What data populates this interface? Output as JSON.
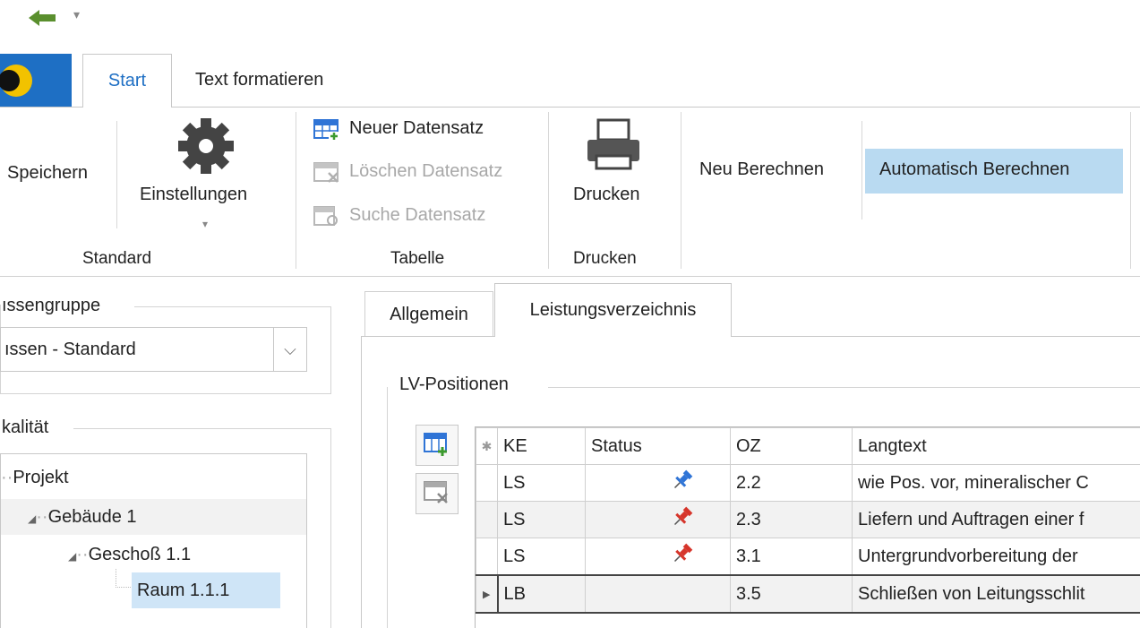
{
  "ribbon": {
    "tabs": [
      "Start",
      "Text formatieren"
    ],
    "buttons": {
      "speichern": "Speichern",
      "einstellungen": "Einstellungen",
      "neuer_datensatz": "Neuer Datensatz",
      "loeschen_datensatz": "Löschen Datensatz",
      "suche_datensatz": "Suche Datensatz",
      "drucken": "Drucken",
      "neu_berechnen": "Neu Berechnen",
      "automatisch_berechnen": "Automatisch Berechnen"
    },
    "groups": [
      "Standard",
      "Tabelle",
      "Drucken"
    ]
  },
  "left_panel": {
    "group1_title": "ıssengruppe",
    "combo_value": "ıssen - Standard",
    "group2_title": "kalität",
    "tree": [
      "Projekt",
      "Gebäude 1",
      "Geschoß 1.1",
      "Raum 1.1.1"
    ]
  },
  "detail_tabs": [
    "Allgemein",
    "Leistungsverzeichnis"
  ],
  "lv_group_title": "LV-Positionen",
  "grid": {
    "columns": [
      "KE",
      "Status",
      "OZ",
      "Langtext"
    ],
    "rows": [
      {
        "ke": "LS",
        "status": "pin-blue",
        "oz": "2.2",
        "langtext": "wie Pos. vor, mineralischer C"
      },
      {
        "ke": "LS",
        "status": "pin-red",
        "oz": "2.3",
        "langtext": "Liefern und Auftragen einer f"
      },
      {
        "ke": "LS",
        "status": "pin-red",
        "oz": "3.1",
        "langtext": "Untergrundvorbereitung der"
      },
      {
        "ke": "LB",
        "status": "",
        "oz": "3.5",
        "langtext": "Schließen von Leitungsschlit"
      }
    ]
  },
  "colors": {
    "accent": "#1e6fc4",
    "highlight": "#b9daf1",
    "pin_blue": "#2f74d6",
    "pin_red": "#d6352b"
  }
}
